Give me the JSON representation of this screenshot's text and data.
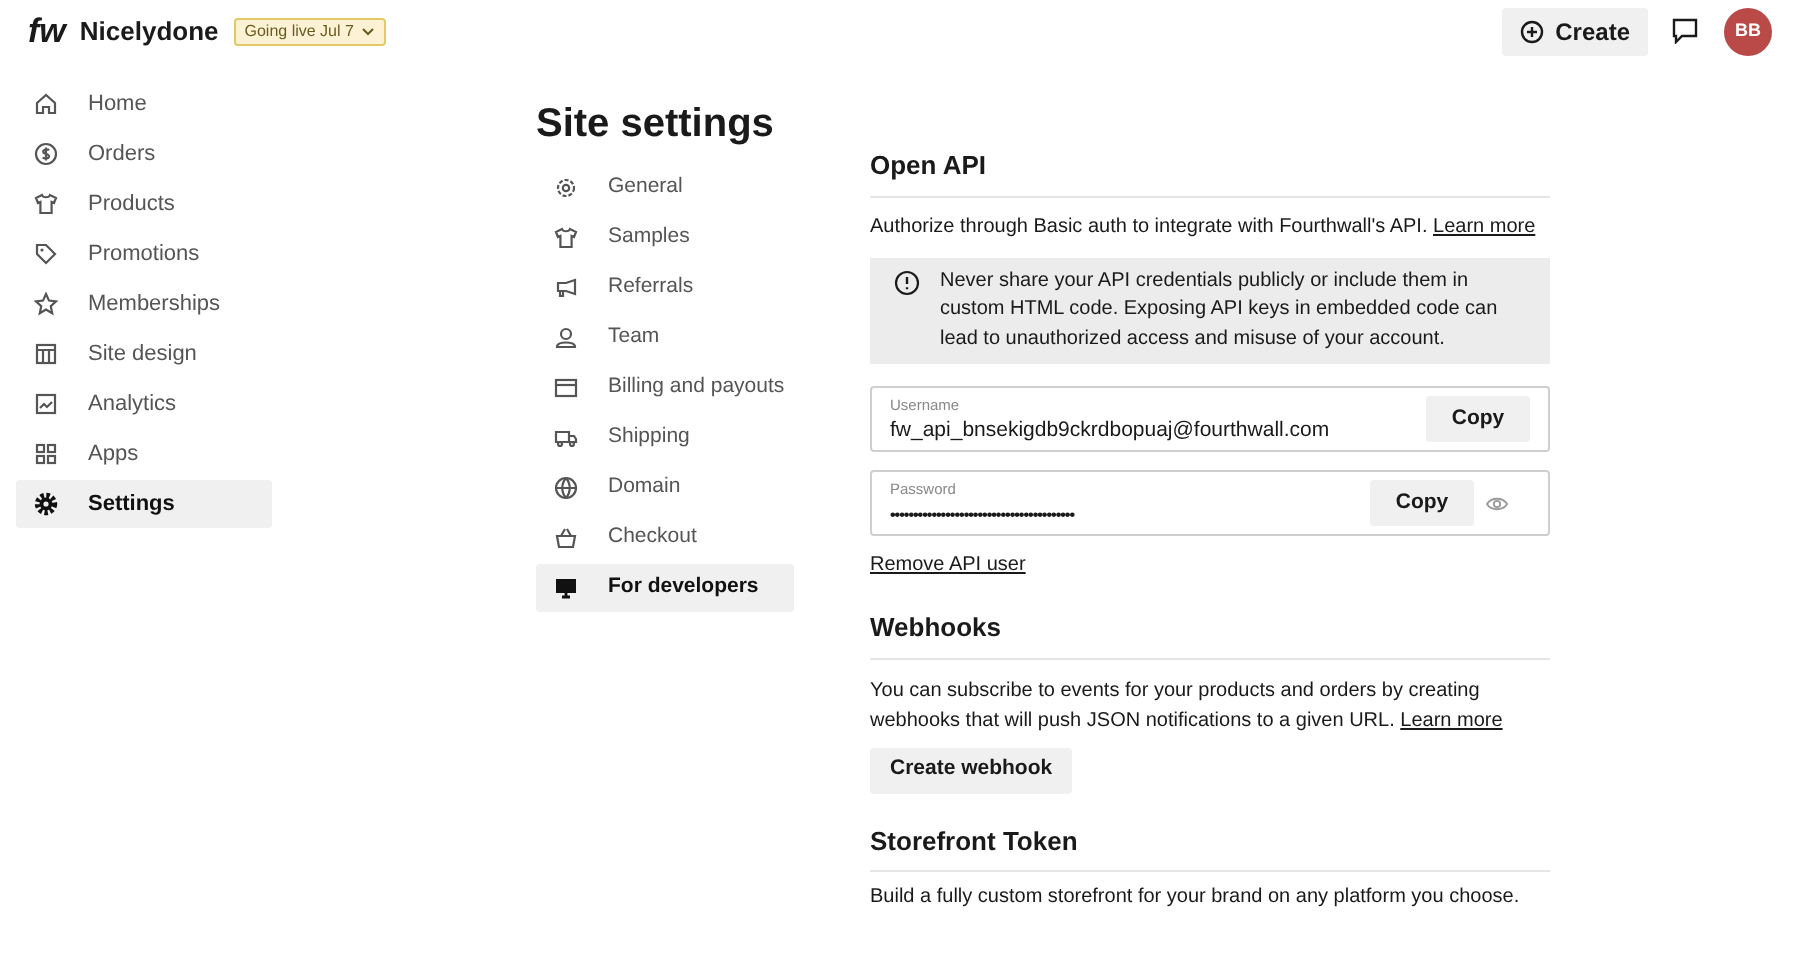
{
  "header": {
    "logo": "fw",
    "store": "Nicelydone",
    "badge": "Going live Jul 7",
    "create": "Create",
    "avatar": "BB"
  },
  "sidebar": {
    "items": [
      {
        "label": "Home",
        "selected": false
      },
      {
        "label": "Orders",
        "selected": false
      },
      {
        "label": "Products",
        "selected": false
      },
      {
        "label": "Promotions",
        "selected": false
      },
      {
        "label": "Memberships",
        "selected": false
      },
      {
        "label": "Site design",
        "selected": false
      },
      {
        "label": "Analytics",
        "selected": false
      },
      {
        "label": "Apps",
        "selected": false
      },
      {
        "label": "Settings",
        "selected": true
      }
    ]
  },
  "page_title": "Site settings",
  "settings_nav": {
    "items": [
      {
        "label": "General",
        "selected": false
      },
      {
        "label": "Samples",
        "selected": false
      },
      {
        "label": "Referrals",
        "selected": false
      },
      {
        "label": "Team",
        "selected": false
      },
      {
        "label": "Billing and payouts",
        "selected": false
      },
      {
        "label": "Shipping",
        "selected": false
      },
      {
        "label": "Domain",
        "selected": false
      },
      {
        "label": "Checkout",
        "selected": false
      },
      {
        "label": "For developers",
        "selected": true
      }
    ]
  },
  "open_api": {
    "title": "Open API",
    "description": "Authorize through Basic auth to integrate with Fourthwall's API.",
    "learn_more": "Learn more",
    "warning": "Never share your API credentials publicly or include them in custom HTML code. Exposing API keys in embedded code can lead to unauthorized access and misuse of your account.",
    "username": {
      "label": "Username",
      "value": "fw_api_bnsekigdb9ckrdbopuaj@fourthwall.com",
      "button": "Copy"
    },
    "password": {
      "label": "Password",
      "value": "••••••••••••••••••••••••••••••••••••••••",
      "button": "Copy"
    },
    "remove": "Remove API user"
  },
  "webhooks": {
    "title": "Webhooks",
    "description": "You can subscribe to events for your products and orders by creating webhooks that will push JSON notifications to a given URL.",
    "learn_more": "Learn more",
    "button": "Create webhook"
  },
  "storefront_token": {
    "title": "Storefront Token",
    "description": "Build a fully custom storefront for your brand on any platform you choose."
  }
}
